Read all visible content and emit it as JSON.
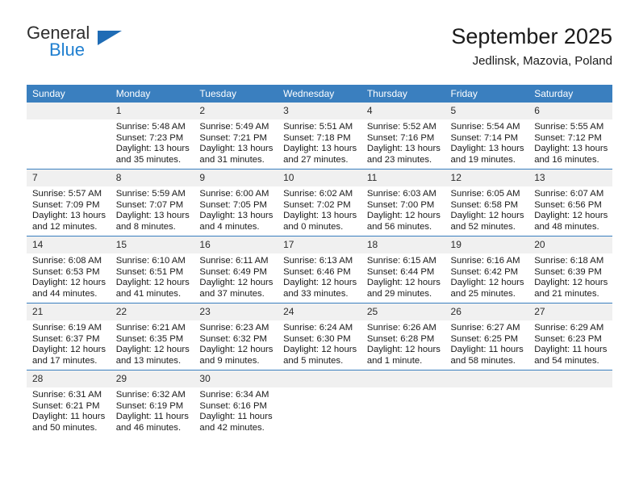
{
  "brand": {
    "name_part1": "General",
    "name_part2": "Blue",
    "triangle_color": "#1f6cb5",
    "blue_color": "#1f7fd0"
  },
  "header": {
    "title": "September 2025",
    "subtitle": "Jedlinsk, Mazovia, Poland"
  },
  "theme": {
    "header_bg": "#3a7fbf",
    "header_text": "#ffffff",
    "daynum_bg": "#f0f0f0",
    "cell_bg": "#ffffff",
    "rule_color": "#3a7fbf"
  },
  "weekday_headers": [
    "Sunday",
    "Monday",
    "Tuesday",
    "Wednesday",
    "Thursday",
    "Friday",
    "Saturday"
  ],
  "weeks": [
    [
      {
        "day": "",
        "blank": true,
        "sunrise": "",
        "sunset": "",
        "daylight1": "",
        "daylight2": ""
      },
      {
        "day": "1",
        "sunrise": "Sunrise: 5:48 AM",
        "sunset": "Sunset: 7:23 PM",
        "daylight1": "Daylight: 13 hours",
        "daylight2": "and 35 minutes."
      },
      {
        "day": "2",
        "sunrise": "Sunrise: 5:49 AM",
        "sunset": "Sunset: 7:21 PM",
        "daylight1": "Daylight: 13 hours",
        "daylight2": "and 31 minutes."
      },
      {
        "day": "3",
        "sunrise": "Sunrise: 5:51 AM",
        "sunset": "Sunset: 7:18 PM",
        "daylight1": "Daylight: 13 hours",
        "daylight2": "and 27 minutes."
      },
      {
        "day": "4",
        "sunrise": "Sunrise: 5:52 AM",
        "sunset": "Sunset: 7:16 PM",
        "daylight1": "Daylight: 13 hours",
        "daylight2": "and 23 minutes."
      },
      {
        "day": "5",
        "sunrise": "Sunrise: 5:54 AM",
        "sunset": "Sunset: 7:14 PM",
        "daylight1": "Daylight: 13 hours",
        "daylight2": "and 19 minutes."
      },
      {
        "day": "6",
        "sunrise": "Sunrise: 5:55 AM",
        "sunset": "Sunset: 7:12 PM",
        "daylight1": "Daylight: 13 hours",
        "daylight2": "and 16 minutes."
      }
    ],
    [
      {
        "day": "7",
        "sunrise": "Sunrise: 5:57 AM",
        "sunset": "Sunset: 7:09 PM",
        "daylight1": "Daylight: 13 hours",
        "daylight2": "and 12 minutes."
      },
      {
        "day": "8",
        "sunrise": "Sunrise: 5:59 AM",
        "sunset": "Sunset: 7:07 PM",
        "daylight1": "Daylight: 13 hours",
        "daylight2": "and 8 minutes."
      },
      {
        "day": "9",
        "sunrise": "Sunrise: 6:00 AM",
        "sunset": "Sunset: 7:05 PM",
        "daylight1": "Daylight: 13 hours",
        "daylight2": "and 4 minutes."
      },
      {
        "day": "10",
        "sunrise": "Sunrise: 6:02 AM",
        "sunset": "Sunset: 7:02 PM",
        "daylight1": "Daylight: 13 hours",
        "daylight2": "and 0 minutes."
      },
      {
        "day": "11",
        "sunrise": "Sunrise: 6:03 AM",
        "sunset": "Sunset: 7:00 PM",
        "daylight1": "Daylight: 12 hours",
        "daylight2": "and 56 minutes."
      },
      {
        "day": "12",
        "sunrise": "Sunrise: 6:05 AM",
        "sunset": "Sunset: 6:58 PM",
        "daylight1": "Daylight: 12 hours",
        "daylight2": "and 52 minutes."
      },
      {
        "day": "13",
        "sunrise": "Sunrise: 6:07 AM",
        "sunset": "Sunset: 6:56 PM",
        "daylight1": "Daylight: 12 hours",
        "daylight2": "and 48 minutes."
      }
    ],
    [
      {
        "day": "14",
        "sunrise": "Sunrise: 6:08 AM",
        "sunset": "Sunset: 6:53 PM",
        "daylight1": "Daylight: 12 hours",
        "daylight2": "and 44 minutes."
      },
      {
        "day": "15",
        "sunrise": "Sunrise: 6:10 AM",
        "sunset": "Sunset: 6:51 PM",
        "daylight1": "Daylight: 12 hours",
        "daylight2": "and 41 minutes."
      },
      {
        "day": "16",
        "sunrise": "Sunrise: 6:11 AM",
        "sunset": "Sunset: 6:49 PM",
        "daylight1": "Daylight: 12 hours",
        "daylight2": "and 37 minutes."
      },
      {
        "day": "17",
        "sunrise": "Sunrise: 6:13 AM",
        "sunset": "Sunset: 6:46 PM",
        "daylight1": "Daylight: 12 hours",
        "daylight2": "and 33 minutes."
      },
      {
        "day": "18",
        "sunrise": "Sunrise: 6:15 AM",
        "sunset": "Sunset: 6:44 PM",
        "daylight1": "Daylight: 12 hours",
        "daylight2": "and 29 minutes."
      },
      {
        "day": "19",
        "sunrise": "Sunrise: 6:16 AM",
        "sunset": "Sunset: 6:42 PM",
        "daylight1": "Daylight: 12 hours",
        "daylight2": "and 25 minutes."
      },
      {
        "day": "20",
        "sunrise": "Sunrise: 6:18 AM",
        "sunset": "Sunset: 6:39 PM",
        "daylight1": "Daylight: 12 hours",
        "daylight2": "and 21 minutes."
      }
    ],
    [
      {
        "day": "21",
        "sunrise": "Sunrise: 6:19 AM",
        "sunset": "Sunset: 6:37 PM",
        "daylight1": "Daylight: 12 hours",
        "daylight2": "and 17 minutes."
      },
      {
        "day": "22",
        "sunrise": "Sunrise: 6:21 AM",
        "sunset": "Sunset: 6:35 PM",
        "daylight1": "Daylight: 12 hours",
        "daylight2": "and 13 minutes."
      },
      {
        "day": "23",
        "sunrise": "Sunrise: 6:23 AM",
        "sunset": "Sunset: 6:32 PM",
        "daylight1": "Daylight: 12 hours",
        "daylight2": "and 9 minutes."
      },
      {
        "day": "24",
        "sunrise": "Sunrise: 6:24 AM",
        "sunset": "Sunset: 6:30 PM",
        "daylight1": "Daylight: 12 hours",
        "daylight2": "and 5 minutes."
      },
      {
        "day": "25",
        "sunrise": "Sunrise: 6:26 AM",
        "sunset": "Sunset: 6:28 PM",
        "daylight1": "Daylight: 12 hours",
        "daylight2": "and 1 minute."
      },
      {
        "day": "26",
        "sunrise": "Sunrise: 6:27 AM",
        "sunset": "Sunset: 6:25 PM",
        "daylight1": "Daylight: 11 hours",
        "daylight2": "and 58 minutes."
      },
      {
        "day": "27",
        "sunrise": "Sunrise: 6:29 AM",
        "sunset": "Sunset: 6:23 PM",
        "daylight1": "Daylight: 11 hours",
        "daylight2": "and 54 minutes."
      }
    ],
    [
      {
        "day": "28",
        "sunrise": "Sunrise: 6:31 AM",
        "sunset": "Sunset: 6:21 PM",
        "daylight1": "Daylight: 11 hours",
        "daylight2": "and 50 minutes."
      },
      {
        "day": "29",
        "sunrise": "Sunrise: 6:32 AM",
        "sunset": "Sunset: 6:19 PM",
        "daylight1": "Daylight: 11 hours",
        "daylight2": "and 46 minutes."
      },
      {
        "day": "30",
        "sunrise": "Sunrise: 6:34 AM",
        "sunset": "Sunset: 6:16 PM",
        "daylight1": "Daylight: 11 hours",
        "daylight2": "and 42 minutes."
      },
      {
        "day": "",
        "blank": true,
        "sunrise": "",
        "sunset": "",
        "daylight1": "",
        "daylight2": ""
      },
      {
        "day": "",
        "blank": true,
        "sunrise": "",
        "sunset": "",
        "daylight1": "",
        "daylight2": ""
      },
      {
        "day": "",
        "blank": true,
        "sunrise": "",
        "sunset": "",
        "daylight1": "",
        "daylight2": ""
      },
      {
        "day": "",
        "blank": true,
        "sunrise": "",
        "sunset": "",
        "daylight1": "",
        "daylight2": ""
      }
    ]
  ]
}
